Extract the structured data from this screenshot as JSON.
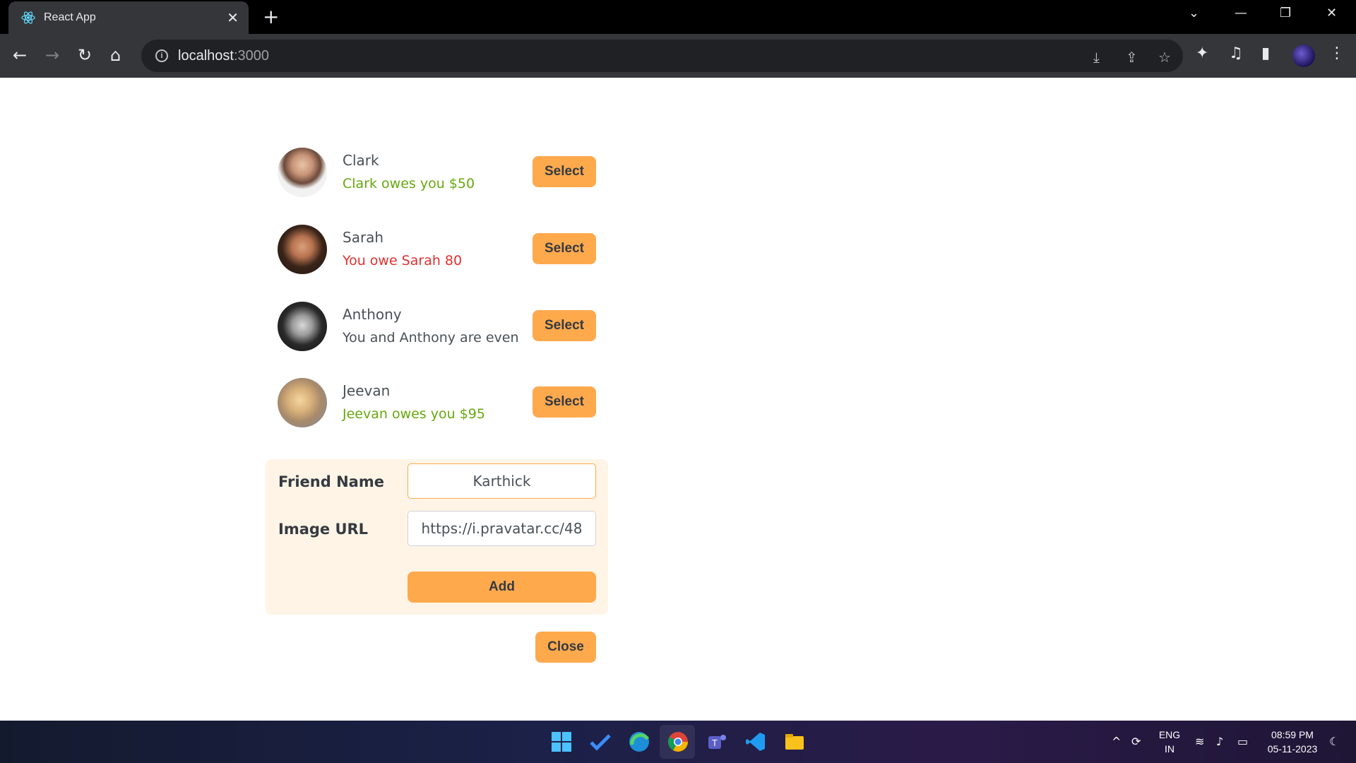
{
  "browser": {
    "tab_title": "React App",
    "url_host": "localhost",
    "url_port": ":3000"
  },
  "friends": [
    {
      "name": "Clark",
      "balance": "Clark owes you $50",
      "status": "green"
    },
    {
      "name": "Sarah",
      "balance": "You owe Sarah 80",
      "status": "red"
    },
    {
      "name": "Anthony",
      "balance": "You and Anthony are even",
      "status": "neutral"
    },
    {
      "name": "Jeevan",
      "balance": "Jeevan owes you $95",
      "status": "green"
    }
  ],
  "select_label": "Select",
  "form": {
    "name_label": "Friend Name",
    "name_value": "Karthick",
    "image_label": "Image URL",
    "image_value": "https://i.pravatar.cc/48",
    "add_label": "Add"
  },
  "close_label": "Close",
  "taskbar": {
    "lang_top": "ENG",
    "lang_bottom": "IN",
    "time": "08:59 PM",
    "date": "05-11-2023"
  },
  "colors": {
    "accent": "#ffa94d",
    "form_bg": "#fff4e6",
    "owed_green": "#66a80f",
    "owe_red": "#e03131"
  },
  "icons": [
    "react-icon",
    "close-tab-icon",
    "new-tab-icon",
    "back-icon",
    "forward-icon",
    "reload-icon",
    "home-icon",
    "info-icon",
    "install-icon",
    "share-icon",
    "star-icon",
    "extensions-icon",
    "media-icon",
    "sidepanel-icon",
    "profile-icon",
    "menu-icon",
    "windows-start-icon",
    "todo-icon",
    "edge-icon",
    "chrome-icon",
    "teams-icon",
    "vscode-icon",
    "explorer-icon",
    "wifi-icon",
    "volume-icon",
    "battery-icon"
  ]
}
